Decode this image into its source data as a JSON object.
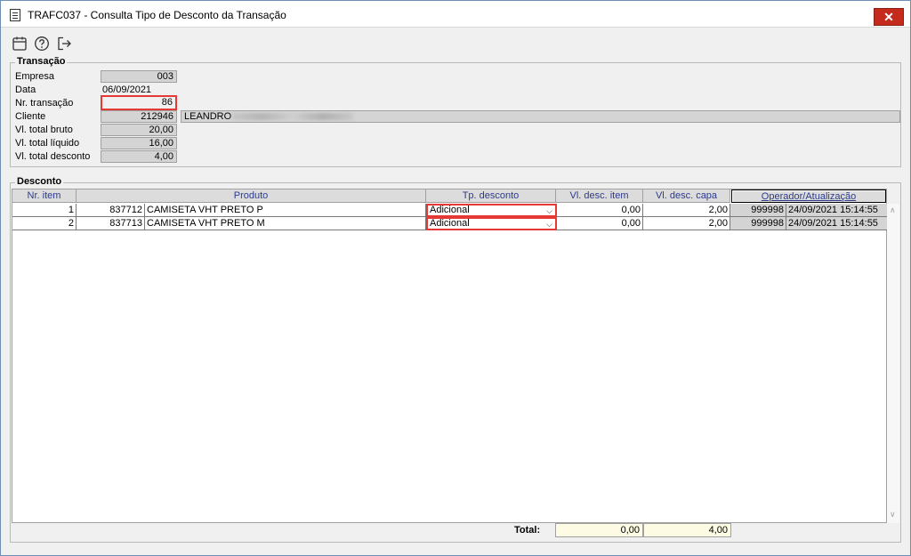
{
  "window": {
    "title": "TRAFC037 - Consulta Tipo de Desconto da Transação",
    "close_label": "✕"
  },
  "toolbar": {
    "icons": [
      "calendar-icon",
      "help-icon",
      "exit-icon"
    ]
  },
  "transacao": {
    "title": "Transação",
    "fields": {
      "empresa": {
        "label": "Empresa",
        "value": "003"
      },
      "data": {
        "label": "Data",
        "value": "06/09/2021"
      },
      "nr_transacao": {
        "label": "Nr. transação",
        "value": "86"
      },
      "cliente": {
        "label": "Cliente",
        "value": "212946",
        "name": "LEANDRO"
      },
      "vl_total_bruto": {
        "label": "Vl. total bruto",
        "value": "20,00"
      },
      "vl_total_liquido": {
        "label": "Vl. total líquido",
        "value": "16,00"
      },
      "vl_total_desconto": {
        "label": "Vl. total desconto",
        "value": "4,00"
      }
    }
  },
  "desconto": {
    "title": "Desconto",
    "columns": [
      "Nr. item",
      "Produto",
      "Tp. desconto",
      "Vl. desc. item",
      "Vl. desc. capa",
      "Operador/Atualização"
    ],
    "rows": [
      {
        "nr_item": "1",
        "produto_codigo": "837712",
        "produto_nome": "CAMISETA VHT PRETO P",
        "tp_desconto": "Adicional",
        "vl_desc_item": "0,00",
        "vl_desc_capa": "2,00",
        "operador": "999998",
        "atualizacao": "24/09/2021 15:14:55"
      },
      {
        "nr_item": "2",
        "produto_codigo": "837713",
        "produto_nome": "CAMISETA VHT PRETO M",
        "tp_desconto": "Adicional",
        "vl_desc_item": "0,00",
        "vl_desc_capa": "2,00",
        "operador": "999998",
        "atualizacao": "24/09/2021 15:14:55"
      }
    ],
    "total": {
      "label": "Total:",
      "vl_desc_item": "0,00",
      "vl_desc_capa": "4,00"
    }
  },
  "colors": {
    "highlight": "#e53935",
    "header_text": "#2b3b8f",
    "total_bg": "#fdfbe3"
  }
}
